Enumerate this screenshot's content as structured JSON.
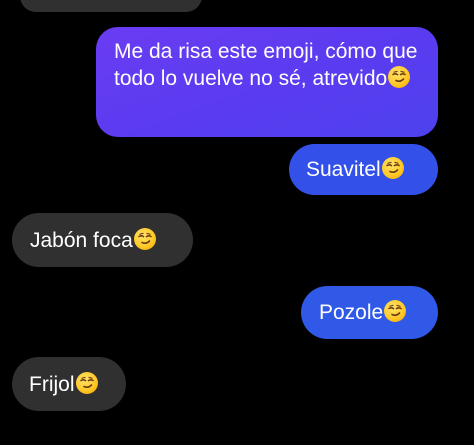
{
  "chat": {
    "messages": [
      {
        "direction": "outgoing",
        "text": "Me da risa este emoji, cómo que todo lo vuelve no sé, atrevido",
        "emoji": "smirking-face"
      },
      {
        "direction": "outgoing",
        "text": "Suavitel",
        "emoji": "smirking-face"
      },
      {
        "direction": "incoming",
        "text": "Jabón foca",
        "emoji": "smirking-face"
      },
      {
        "direction": "outgoing",
        "text": "Pozole",
        "emoji": "smirking-face"
      },
      {
        "direction": "incoming",
        "text": "Frijol",
        "emoji": "smirking-face"
      }
    ]
  },
  "colors": {
    "background": "#000000",
    "incoming_bubble": "#303030",
    "outgoing_purple": "#5a3bf0",
    "outgoing_blue": "#3350e8",
    "text": "#ffffff",
    "emoji_yellow": "#ffc928"
  }
}
